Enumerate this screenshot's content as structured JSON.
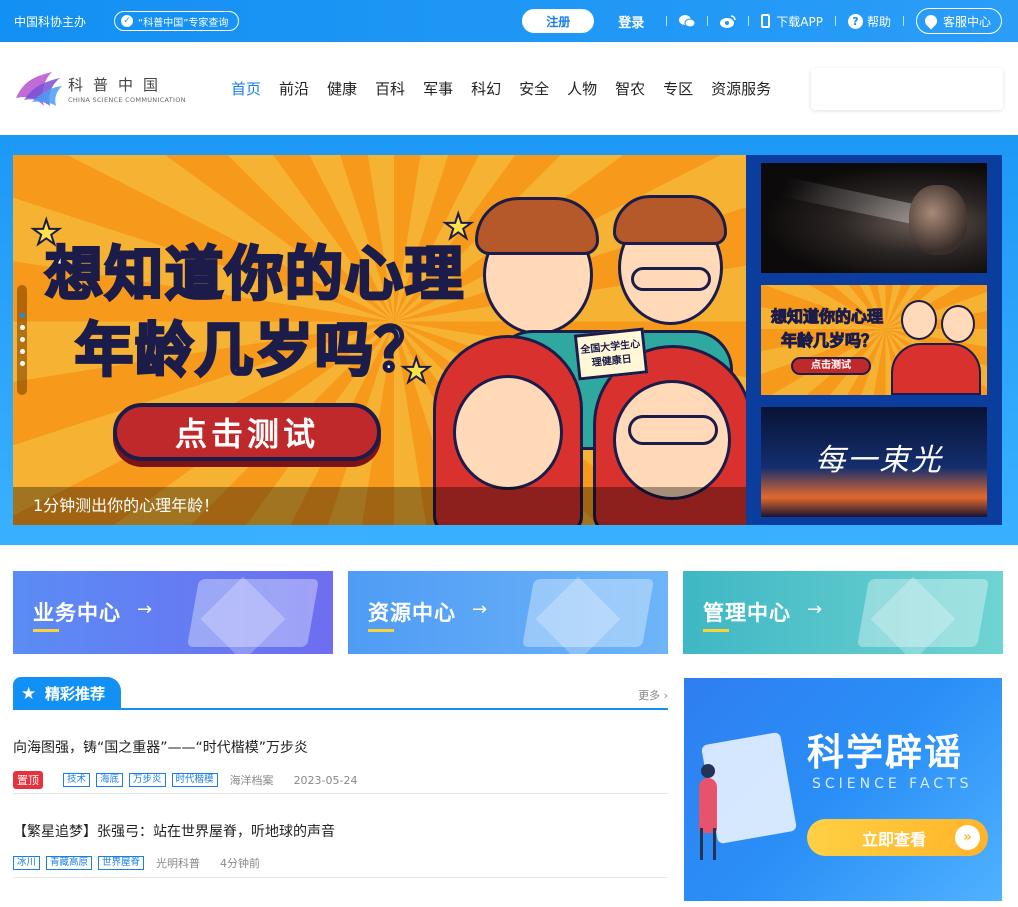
{
  "topbar": {
    "sponsor": "中国科协主办",
    "expert_query": "“科普中国”专家查询",
    "register": "注册",
    "login": "登录",
    "download_app": "下载APP",
    "help": "帮助",
    "customer_service": "客服中心"
  },
  "header": {
    "logo_cn": "科普中国",
    "logo_en": "CHINA SCIENCE COMMUNICATION",
    "nav": [
      "首页",
      "前沿",
      "健康",
      "百科",
      "军事",
      "科幻",
      "安全",
      "人物",
      "智农",
      "专区",
      "资源服务"
    ],
    "active_nav": "首页",
    "search_placeholder": ""
  },
  "banner": {
    "headline_line1": "想知道你的心理",
    "headline_line2": "年龄几岁吗？",
    "cta": "点击测试",
    "sign": "全国大学生心理健康日",
    "caption": "1分钟测出你的心理年龄！",
    "slide_count": 5,
    "active_slide": 1,
    "thumbnails": [
      {
        "name": "face-in-light"
      },
      {
        "line1": "想知道你的心理",
        "line2": "年龄几岁吗？",
        "cta": "点击测试"
      },
      {
        "title": "每一束光"
      }
    ]
  },
  "cards": [
    {
      "label": "业务中心",
      "arrow": "→"
    },
    {
      "label": "资源中心",
      "arrow": "→"
    },
    {
      "label": "管理中心",
      "arrow": "→"
    }
  ],
  "recommend": {
    "title": "精彩推荐",
    "more": "更多",
    "articles": [
      {
        "title": "向海图强，铸“国之重器”——“时代楷模”万步炎",
        "pinned": "置顶",
        "tags": [
          "技术",
          "海底",
          "万步炎",
          "时代楷模"
        ],
        "source": "海洋档案",
        "time": "2023-05-24"
      },
      {
        "title": "【繁星追梦】张强弓：站在世界屋脊，听地球的声音",
        "pinned": "",
        "tags": [
          "冰川",
          "青藏高原",
          "世界屋脊"
        ],
        "source": "光明科普",
        "time": "4分钟前"
      }
    ]
  },
  "promo": {
    "title": "科学辟谣",
    "subtitle": "SCIENCE FACTS",
    "button": "立即查看"
  },
  "colors": {
    "primary": "#1390f3",
    "accent_yellow": "#f9d33a",
    "pinned_red": "#e5323d"
  }
}
